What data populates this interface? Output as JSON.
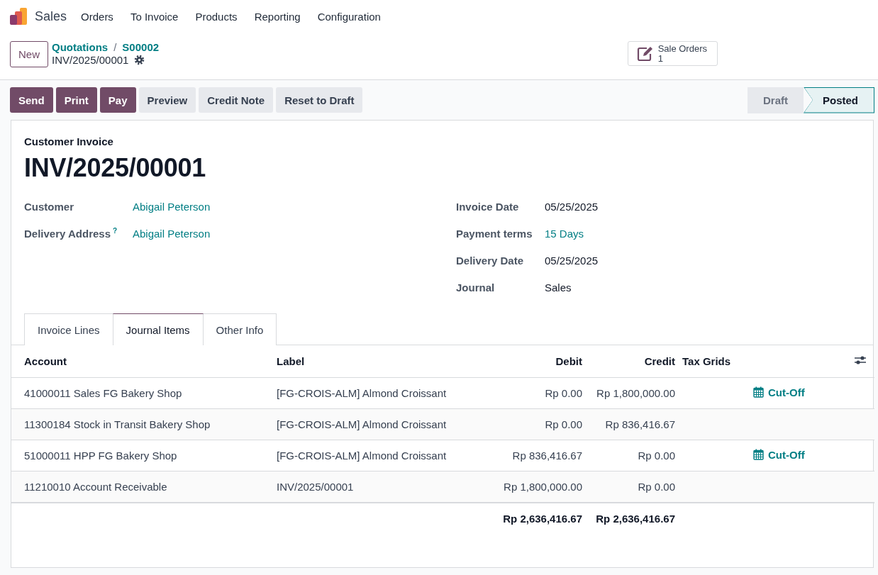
{
  "navbar": {
    "app": "Sales",
    "menu": [
      "Orders",
      "To Invoice",
      "Products",
      "Reporting",
      "Configuration"
    ]
  },
  "control_panel": {
    "new_button": "New",
    "breadcrumbs": [
      "Quotations",
      "S00002"
    ],
    "breadcrumb_separator": "/",
    "record": "INV/2025/00001",
    "smart_button": {
      "label": "Sale Orders",
      "count": "1"
    }
  },
  "actions": [
    {
      "label": "Send",
      "kind": "primary"
    },
    {
      "label": "Print",
      "kind": "primary"
    },
    {
      "label": "Pay",
      "kind": "primary"
    },
    {
      "label": "Preview",
      "kind": "secondary"
    },
    {
      "label": "Credit Note",
      "kind": "secondary"
    },
    {
      "label": "Reset to Draft",
      "kind": "secondary"
    }
  ],
  "statusbar": [
    {
      "label": "Draft",
      "selected": false
    },
    {
      "label": "Posted",
      "selected": true
    }
  ],
  "form": {
    "type_label": "Customer Invoice",
    "name": "INV/2025/00001",
    "left_fields": [
      {
        "label": "Customer",
        "value": "Abigail Peterson",
        "link": true
      },
      {
        "label": "Delivery Address",
        "help": "?",
        "value": "Abigail Peterson",
        "link": true
      }
    ],
    "right_fields": [
      {
        "label": "Invoice Date",
        "value": "05/25/2025",
        "link": false
      },
      {
        "label": "Payment terms",
        "value": "15 Days",
        "link": true
      },
      {
        "label": "Delivery Date",
        "value": "05/25/2025",
        "link": false
      },
      {
        "label": "Journal",
        "value": "Sales",
        "link": false
      }
    ]
  },
  "tabs": [
    {
      "label": "Invoice Lines",
      "selected": false
    },
    {
      "label": "Journal Items",
      "selected": true
    },
    {
      "label": "Other Info",
      "selected": false
    }
  ],
  "table": {
    "columns": [
      {
        "label": "Account",
        "kind": "text"
      },
      {
        "label": "Label",
        "kind": "text"
      },
      {
        "label": "Debit",
        "kind": "amount"
      },
      {
        "label": "Credit",
        "kind": "amount"
      },
      {
        "label": "Tax Grids",
        "kind": "text"
      }
    ],
    "rows": [
      {
        "account": "41000011 Sales FG Bakery Shop",
        "label": "[FG-CROIS-ALM] Almond Croissant",
        "debit": "Rp 0.00",
        "credit": "Rp 1,800,000.00",
        "cut_off": "Cut-Off"
      },
      {
        "account": "11300184 Stock in Transit Bakery Shop",
        "label": "[FG-CROIS-ALM] Almond Croissant",
        "debit": "Rp 0.00",
        "credit": "Rp 836,416.67"
      },
      {
        "account": "51000011 HPP FG Bakery Shop",
        "label": "[FG-CROIS-ALM] Almond Croissant",
        "debit": "Rp 836,416.67",
        "credit": "Rp 0.00",
        "cut_off": "Cut-Off"
      },
      {
        "account": "11210010 Account Receivable",
        "label": "INV/2025/00001",
        "debit": "Rp 1,800,000.00",
        "credit": "Rp 0.00"
      }
    ],
    "totals": {
      "debit": "Rp 2,636,416.67",
      "credit": "Rp 2,636,416.67"
    }
  }
}
